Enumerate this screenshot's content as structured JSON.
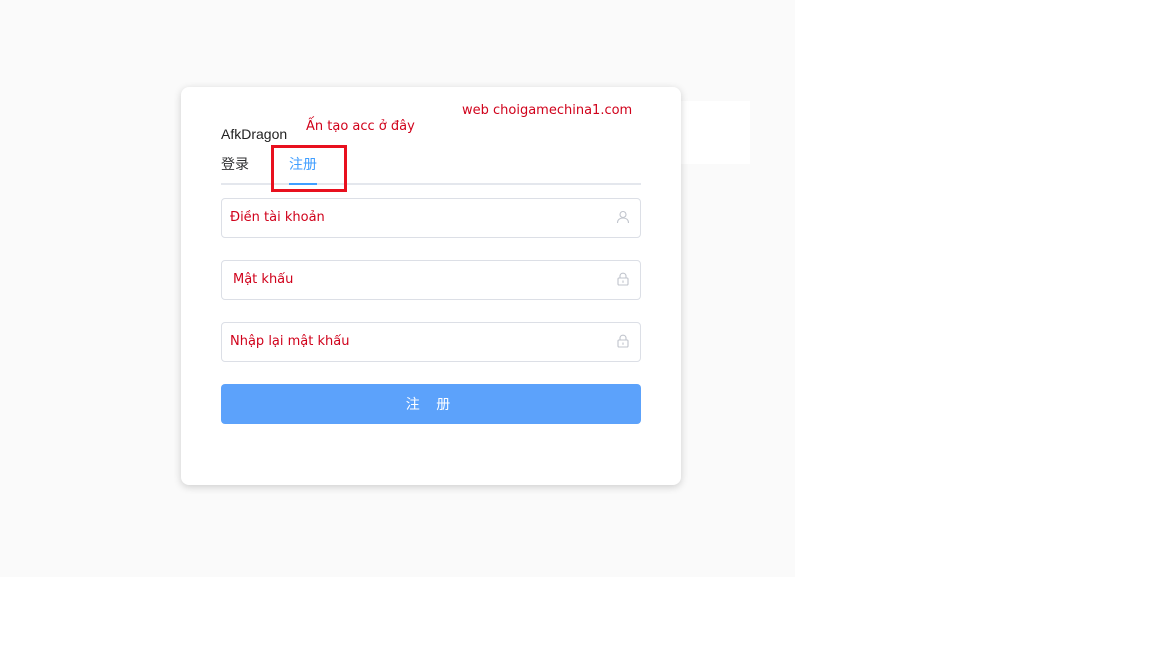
{
  "brand": {
    "title": "AfkDragon"
  },
  "tabs": [
    {
      "label": "登录",
      "active": false
    },
    {
      "label": "注册",
      "active": true
    }
  ],
  "form": {
    "username": {
      "value": "",
      "placeholder": "Điền tài khoản",
      "icon": "user-icon"
    },
    "password": {
      "value": "",
      "placeholder": "Mật khẩu",
      "icon": "lock-icon"
    },
    "confirm_password": {
      "value": "",
      "placeholder": "Nhập lại mật khẩu",
      "icon": "lock-icon"
    },
    "submit_label": "注 册"
  },
  "annotations": {
    "tab_hint": "Ấn tạo acc ở đây",
    "website": "web choigamechina1.com",
    "highlight_color": "#e8101e"
  },
  "colors": {
    "accent": "#409eff",
    "button": "#5ca2fb",
    "annotation_text": "#d0021b"
  }
}
